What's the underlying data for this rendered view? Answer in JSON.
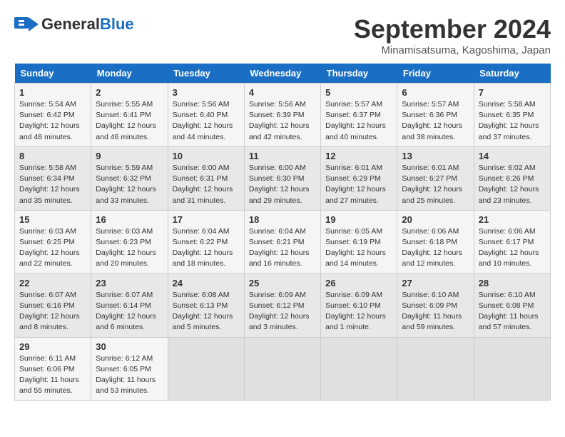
{
  "header": {
    "logo_general": "General",
    "logo_blue": "Blue",
    "month": "September 2024",
    "location": "Minamisatsuma, Kagoshima, Japan"
  },
  "weekdays": [
    "Sunday",
    "Monday",
    "Tuesday",
    "Wednesday",
    "Thursday",
    "Friday",
    "Saturday"
  ],
  "weeks": [
    [
      {
        "day": "1",
        "lines": [
          "Sunrise: 5:54 AM",
          "Sunset: 6:42 PM",
          "Daylight: 12 hours",
          "and 48 minutes."
        ]
      },
      {
        "day": "2",
        "lines": [
          "Sunrise: 5:55 AM",
          "Sunset: 6:41 PM",
          "Daylight: 12 hours",
          "and 46 minutes."
        ]
      },
      {
        "day": "3",
        "lines": [
          "Sunrise: 5:56 AM",
          "Sunset: 6:40 PM",
          "Daylight: 12 hours",
          "and 44 minutes."
        ]
      },
      {
        "day": "4",
        "lines": [
          "Sunrise: 5:56 AM",
          "Sunset: 6:39 PM",
          "Daylight: 12 hours",
          "and 42 minutes."
        ]
      },
      {
        "day": "5",
        "lines": [
          "Sunrise: 5:57 AM",
          "Sunset: 6:37 PM",
          "Daylight: 12 hours",
          "and 40 minutes."
        ]
      },
      {
        "day": "6",
        "lines": [
          "Sunrise: 5:57 AM",
          "Sunset: 6:36 PM",
          "Daylight: 12 hours",
          "and 38 minutes."
        ]
      },
      {
        "day": "7",
        "lines": [
          "Sunrise: 5:58 AM",
          "Sunset: 6:35 PM",
          "Daylight: 12 hours",
          "and 37 minutes."
        ]
      }
    ],
    [
      {
        "day": "8",
        "lines": [
          "Sunrise: 5:58 AM",
          "Sunset: 6:34 PM",
          "Daylight: 12 hours",
          "and 35 minutes."
        ]
      },
      {
        "day": "9",
        "lines": [
          "Sunrise: 5:59 AM",
          "Sunset: 6:32 PM",
          "Daylight: 12 hours",
          "and 33 minutes."
        ]
      },
      {
        "day": "10",
        "lines": [
          "Sunrise: 6:00 AM",
          "Sunset: 6:31 PM",
          "Daylight: 12 hours",
          "and 31 minutes."
        ]
      },
      {
        "day": "11",
        "lines": [
          "Sunrise: 6:00 AM",
          "Sunset: 6:30 PM",
          "Daylight: 12 hours",
          "and 29 minutes."
        ]
      },
      {
        "day": "12",
        "lines": [
          "Sunrise: 6:01 AM",
          "Sunset: 6:29 PM",
          "Daylight: 12 hours",
          "and 27 minutes."
        ]
      },
      {
        "day": "13",
        "lines": [
          "Sunrise: 6:01 AM",
          "Sunset: 6:27 PM",
          "Daylight: 12 hours",
          "and 25 minutes."
        ]
      },
      {
        "day": "14",
        "lines": [
          "Sunrise: 6:02 AM",
          "Sunset: 6:26 PM",
          "Daylight: 12 hours",
          "and 23 minutes."
        ]
      }
    ],
    [
      {
        "day": "15",
        "lines": [
          "Sunrise: 6:03 AM",
          "Sunset: 6:25 PM",
          "Daylight: 12 hours",
          "and 22 minutes."
        ]
      },
      {
        "day": "16",
        "lines": [
          "Sunrise: 6:03 AM",
          "Sunset: 6:23 PM",
          "Daylight: 12 hours",
          "and 20 minutes."
        ]
      },
      {
        "day": "17",
        "lines": [
          "Sunrise: 6:04 AM",
          "Sunset: 6:22 PM",
          "Daylight: 12 hours",
          "and 18 minutes."
        ]
      },
      {
        "day": "18",
        "lines": [
          "Sunrise: 6:04 AM",
          "Sunset: 6:21 PM",
          "Daylight: 12 hours",
          "and 16 minutes."
        ]
      },
      {
        "day": "19",
        "lines": [
          "Sunrise: 6:05 AM",
          "Sunset: 6:19 PM",
          "Daylight: 12 hours",
          "and 14 minutes."
        ]
      },
      {
        "day": "20",
        "lines": [
          "Sunrise: 6:06 AM",
          "Sunset: 6:18 PM",
          "Daylight: 12 hours",
          "and 12 minutes."
        ]
      },
      {
        "day": "21",
        "lines": [
          "Sunrise: 6:06 AM",
          "Sunset: 6:17 PM",
          "Daylight: 12 hours",
          "and 10 minutes."
        ]
      }
    ],
    [
      {
        "day": "22",
        "lines": [
          "Sunrise: 6:07 AM",
          "Sunset: 6:16 PM",
          "Daylight: 12 hours",
          "and 8 minutes."
        ]
      },
      {
        "day": "23",
        "lines": [
          "Sunrise: 6:07 AM",
          "Sunset: 6:14 PM",
          "Daylight: 12 hours",
          "and 6 minutes."
        ]
      },
      {
        "day": "24",
        "lines": [
          "Sunrise: 6:08 AM",
          "Sunset: 6:13 PM",
          "Daylight: 12 hours",
          "and 5 minutes."
        ]
      },
      {
        "day": "25",
        "lines": [
          "Sunrise: 6:09 AM",
          "Sunset: 6:12 PM",
          "Daylight: 12 hours",
          "and 3 minutes."
        ]
      },
      {
        "day": "26",
        "lines": [
          "Sunrise: 6:09 AM",
          "Sunset: 6:10 PM",
          "Daylight: 12 hours",
          "and 1 minute."
        ]
      },
      {
        "day": "27",
        "lines": [
          "Sunrise: 6:10 AM",
          "Sunset: 6:09 PM",
          "Daylight: 11 hours",
          "and 59 minutes."
        ]
      },
      {
        "day": "28",
        "lines": [
          "Sunrise: 6:10 AM",
          "Sunset: 6:08 PM",
          "Daylight: 11 hours",
          "and 57 minutes."
        ]
      }
    ],
    [
      {
        "day": "29",
        "lines": [
          "Sunrise: 6:11 AM",
          "Sunset: 6:06 PM",
          "Daylight: 11 hours",
          "and 55 minutes."
        ]
      },
      {
        "day": "30",
        "lines": [
          "Sunrise: 6:12 AM",
          "Sunset: 6:05 PM",
          "Daylight: 11 hours",
          "and 53 minutes."
        ]
      },
      {
        "day": "",
        "lines": []
      },
      {
        "day": "",
        "lines": []
      },
      {
        "day": "",
        "lines": []
      },
      {
        "day": "",
        "lines": []
      },
      {
        "day": "",
        "lines": []
      }
    ]
  ]
}
